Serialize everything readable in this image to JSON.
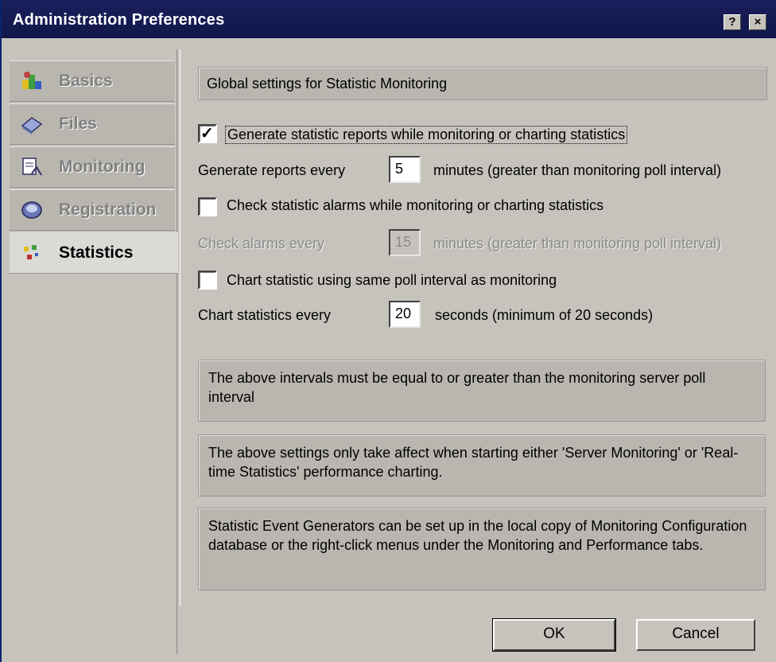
{
  "window": {
    "title": "Administration Preferences",
    "help_btn": "?",
    "close_btn": "×"
  },
  "sidebar": {
    "items": [
      {
        "label": "Basics",
        "icon": "basics-icon"
      },
      {
        "label": "Files",
        "icon": "files-icon"
      },
      {
        "label": "Monitoring",
        "icon": "monitoring-icon"
      },
      {
        "label": "Registration",
        "icon": "registration-icon"
      },
      {
        "label": "Statistics",
        "icon": "statistics-icon",
        "active": true
      }
    ]
  },
  "main": {
    "header": "Global settings for Statistic Monitoring",
    "generate_reports_checkbox": {
      "label": "Generate statistic reports while monitoring or charting statistics",
      "checked": true
    },
    "generate_reports_row": {
      "prefix": "Generate reports every",
      "value": "5",
      "suffix": "minutes (greater than monitoring poll interval)"
    },
    "check_alarms_checkbox": {
      "label": "Check statistic alarms while monitoring or charting statistics",
      "checked": false
    },
    "check_alarms_row": {
      "prefix": "Check alarms every",
      "value": "15",
      "suffix": "minutes (greater than monitoring poll interval)",
      "disabled": true
    },
    "chart_same_checkbox": {
      "label": "Chart statistic using same poll interval as monitoring",
      "checked": false
    },
    "chart_row": {
      "prefix": "Chart statistics every",
      "value": "20",
      "suffix": "seconds (minimum of 20 seconds)"
    },
    "notes": [
      "The above intervals must be equal to or greater than the monitoring server poll interval",
      "The above settings only take affect when starting either 'Server Monitoring' or 'Real-time Statistics' performance charting.",
      "Statistic Event Generators can be set up in the local copy of Monitoring Configuration database or the right-click menus under the Monitoring and Performance tabs."
    ]
  },
  "buttons": {
    "ok": "OK",
    "cancel": "Cancel"
  },
  "colors": {
    "titlebar": "#11164a",
    "dialog_bg": "#c6c3bd"
  }
}
